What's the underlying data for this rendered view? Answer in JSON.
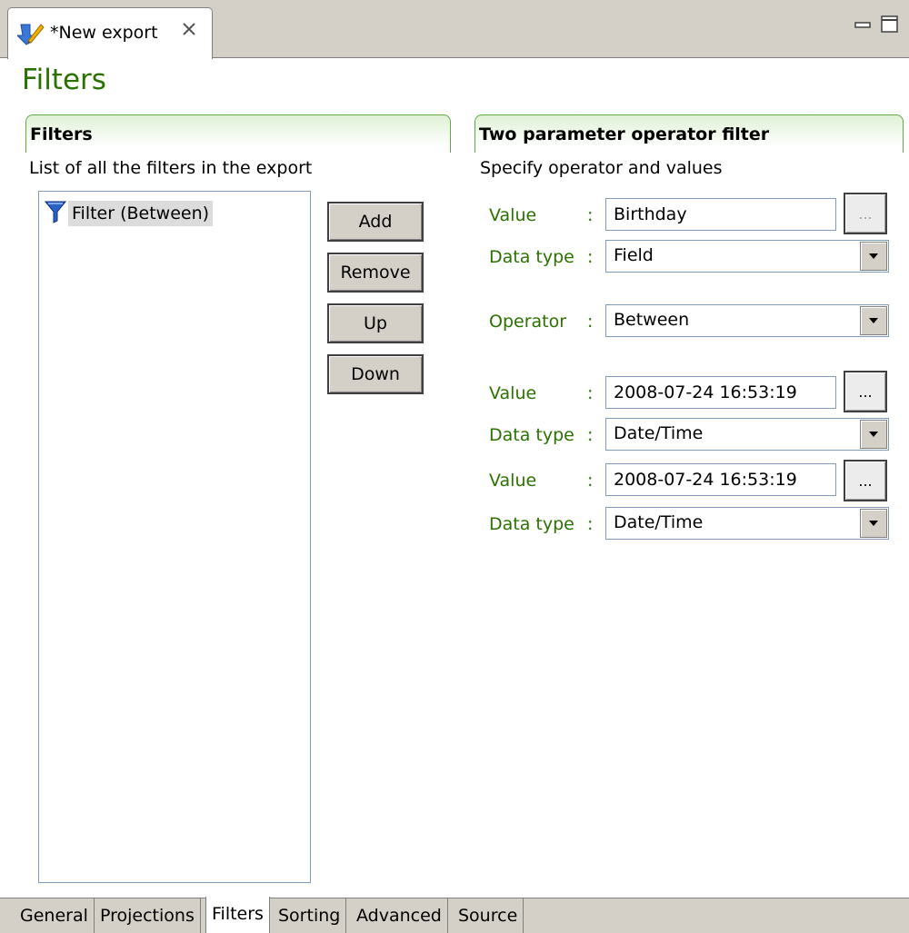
{
  "editor": {
    "tab_title": "*New export",
    "tab_icon": "export-icon",
    "close_icon": "close-icon"
  },
  "page": {
    "title": "Filters"
  },
  "left_section": {
    "title": "Filters",
    "description": "List of all the filters in the export",
    "items": [
      {
        "label": "Filter (Between)",
        "icon": "filter-funnel-icon"
      }
    ],
    "buttons": {
      "add": "Add",
      "remove": "Remove",
      "up": "Up",
      "down": "Down"
    }
  },
  "right_section": {
    "title": "Two parameter operator filter",
    "description": "Specify operator and values",
    "colon": ":",
    "browse_label": "...",
    "value1": {
      "label": "Value",
      "value": "Birthday"
    },
    "datatype1": {
      "label": "Data type",
      "value": "Field"
    },
    "operator": {
      "label": "Operator",
      "value": "Between"
    },
    "value2": {
      "label": "Value",
      "value": "2008-07-24 16:53:19"
    },
    "datatype2": {
      "label": "Data type",
      "value": "Date/Time"
    },
    "value3": {
      "label": "Value",
      "value": "2008-07-24 16:53:19"
    },
    "datatype3": {
      "label": "Data type",
      "value": "Date/Time"
    }
  },
  "page_tabs": [
    {
      "label": "General"
    },
    {
      "label": "Projections"
    },
    {
      "label": "Filters",
      "active": true
    },
    {
      "label": "Sorting"
    },
    {
      "label": "Advanced"
    },
    {
      "label": "Source"
    }
  ],
  "colors": {
    "accent_green": "#2a7200",
    "header_border": "#5faa44",
    "chrome": "#d4d0c8"
  }
}
